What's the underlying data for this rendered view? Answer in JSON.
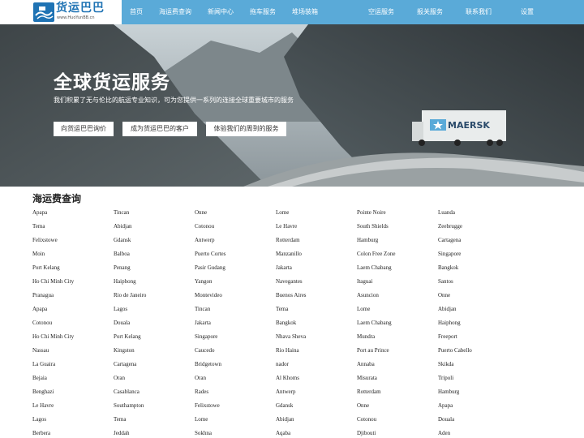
{
  "nav": {
    "logo_title": "货运巴巴",
    "logo_sub": "www.HuoYunBB.cn",
    "items": [
      "首页",
      "海运费查询",
      "新闻中心",
      "拖车服务",
      "堆场装箱",
      "空运服务",
      "报关服务",
      "联系我们",
      "设置"
    ]
  },
  "hero": {
    "title": "全球货运服务",
    "subtitle": "我们积累了无与伦比的航运专业知识，可为您提供一系列的连接全球重要城市的服务",
    "buttons": [
      "向货运巴巴询价",
      "成为货运巴巴的客户",
      "体验我们的周到的服务"
    ],
    "container_text": "MAERSK"
  },
  "rates": {
    "title": "海运费查询",
    "rows": [
      [
        "Apapa",
        "Tincan",
        "Onne",
        "Lome",
        "Pointe Noire",
        "Luanda"
      ],
      [
        "Tema",
        "Abidjan",
        "Cotonou",
        "Le Havre",
        "South Shields",
        "Zeebrugge"
      ],
      [
        "Felixstowe",
        "Gdansk",
        "Antwerp",
        "Rotterdam",
        "Hamburg",
        "Cartagena"
      ],
      [
        "Moin",
        "Balboa",
        "Puerto Cortes",
        "Manzanillo",
        "Colon Free Zone",
        "Singapore"
      ],
      [
        "Port Kelang",
        "Penang",
        "Pasir Gudang",
        "Jakarta",
        "Laem Chabang",
        "Bangkok"
      ],
      [
        "Ho Chi Minh City",
        "Haiphong",
        "Yangon",
        "Navegantes",
        "Itaguai",
        "Santos"
      ],
      [
        "Pranagua",
        "Rio de Janeiro",
        "Montevideo",
        "Buenos Aires",
        "Asuncion",
        "Onne"
      ],
      [
        "Apapa",
        "Lagos",
        "Tincan",
        "Tema",
        "Lome",
        "Abidjan"
      ],
      [
        "Cotonou",
        "Douala",
        "Jakarta",
        "Bangkok",
        "Laem Chabang",
        "Haiphong"
      ],
      [
        "Ho Chi Minh City",
        "Port Kelang",
        "Singapore",
        "Nhava Sheva",
        "Mundra",
        "Freeport"
      ],
      [
        "Nassau",
        "Kingston",
        "Caucedo",
        "Rio Haina",
        "Port au Prince",
        "Puerto Cabello"
      ],
      [
        "La Guaira",
        "Cartagena",
        "Bridgetown",
        "nador",
        "Annaba",
        "Skikda"
      ],
      [
        "Bejaia",
        "Oran",
        "Oran",
        "Al Khoms",
        "Misurata",
        "Tripoli"
      ],
      [
        "Benghazi",
        "Casablanca",
        "Rades",
        "Antwerp",
        "Rotterdam",
        "Hamburg"
      ],
      [
        "Le Havre",
        "Southampton",
        "Felixstowe",
        "Gdansk",
        "Onne",
        "Apapa"
      ],
      [
        "Lagos",
        "Tema",
        "Lome",
        "Abidjan",
        "Cotonou",
        "Douala"
      ],
      [
        "Berbera",
        "Jeddah",
        "Sokhna",
        "Aqaba",
        "Djibouti",
        "Aden"
      ]
    ]
  },
  "colors": {
    "nav_bg": "#5aaad8",
    "brand": "#1f73b4"
  }
}
